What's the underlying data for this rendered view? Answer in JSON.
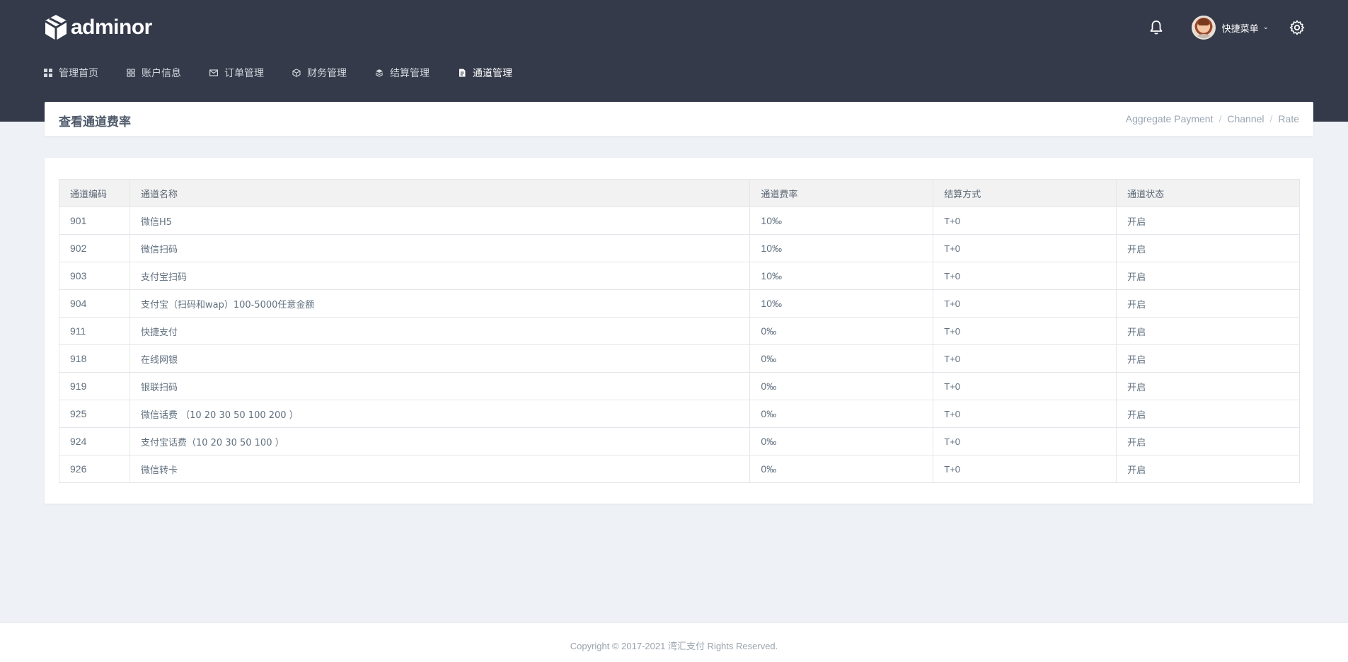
{
  "brand": {
    "name": "adminor"
  },
  "header": {
    "user_menu_label": "快捷菜单",
    "icons": {
      "notifications": "bell-icon",
      "settings": "gear-icon",
      "user_menu": "chevron-down-icon"
    }
  },
  "nav": {
    "items": [
      {
        "label": "管理首页",
        "icon": "grid-icon"
      },
      {
        "label": "账户信息",
        "icon": "user-card-icon"
      },
      {
        "label": "订单管理",
        "icon": "mail-icon"
      },
      {
        "label": "财务管理",
        "icon": "cube-icon"
      },
      {
        "label": "结算管理",
        "icon": "layers-icon"
      },
      {
        "label": "通道管理",
        "icon": "document-icon",
        "active": true
      }
    ]
  },
  "page": {
    "title": "查看通道费率",
    "breadcrumb": [
      "Aggregate Payment",
      "Channel",
      "Rate"
    ],
    "breadcrumb_separator": "/"
  },
  "table": {
    "headers": [
      "通道编码",
      "通道名称",
      "通道费率",
      "结算方式",
      "通道状态"
    ],
    "rows": [
      {
        "code": "901",
        "name": "微信H5",
        "rate": "10‰",
        "settle": "T+0",
        "status": "开启"
      },
      {
        "code": "902",
        "name": "微信扫码",
        "rate": "10‰",
        "settle": "T+0",
        "status": "开启"
      },
      {
        "code": "903",
        "name": "支付宝扫码",
        "rate": "10‰",
        "settle": "T+0",
        "status": "开启"
      },
      {
        "code": "904",
        "name": "支付宝（扫码和wap）100-5000任意金额",
        "rate": "10‰",
        "settle": "T+0",
        "status": "开启"
      },
      {
        "code": "911",
        "name": "快捷支付",
        "rate": "0‰",
        "settle": "T+0",
        "status": "开启"
      },
      {
        "code": "918",
        "name": "在线网银",
        "rate": "0‰",
        "settle": "T+0",
        "status": "开启"
      },
      {
        "code": "919",
        "name": "银联扫码",
        "rate": "0‰",
        "settle": "T+0",
        "status": "开启"
      },
      {
        "code": "925",
        "name": "微信话费 （10 20 30 50 100 200 ）",
        "rate": "0‰",
        "settle": "T+0",
        "status": "开启"
      },
      {
        "code": "924",
        "name": "支付宝话费（10 20 30 50 100 ）",
        "rate": "0‰",
        "settle": "T+0",
        "status": "开启"
      },
      {
        "code": "926",
        "name": "微信转卡",
        "rate": "0‰",
        "settle": "T+0",
        "status": "开启"
      }
    ]
  },
  "footer": {
    "copyright": "Copyright © 2017-2021 湾汇支付 Rights Reserved."
  },
  "colors": {
    "topbar": "#343a49",
    "background": "#eef1f5",
    "card": "#ffffff"
  }
}
